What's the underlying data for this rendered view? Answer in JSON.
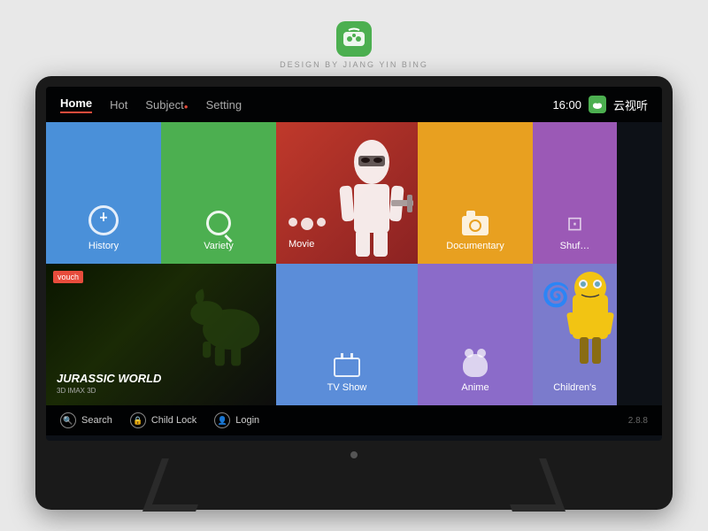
{
  "brand": {
    "tagline": "DESIGN BY JIANG YIN BING"
  },
  "nav": {
    "items": [
      {
        "label": "Home",
        "active": true
      },
      {
        "label": "Hot",
        "active": false
      },
      {
        "label": "Subject",
        "active": false,
        "dot": true
      },
      {
        "label": "Setting",
        "active": false
      }
    ],
    "time": "16:00",
    "service": "云视听"
  },
  "tiles": [
    {
      "id": "history",
      "label": "History",
      "color": "#4a90d9"
    },
    {
      "id": "variety",
      "label": "Variety",
      "color": "#4CAF50"
    },
    {
      "id": "movie",
      "label": "Movie",
      "color": "#e74c3c"
    },
    {
      "id": "documentary",
      "label": "Documentary",
      "color": "#e8a020"
    },
    {
      "id": "shuffle",
      "label": "Shuf…",
      "color": "#9b59b6"
    },
    {
      "id": "jurassic",
      "label": "JURASSIC WORLD",
      "sublabel": "3D IMAX 3D",
      "badge": "vouch"
    },
    {
      "id": "tvshow",
      "label": "TV Show",
      "color": "#5b8dd9"
    },
    {
      "id": "anime",
      "label": "Anime",
      "color": "#8b6bc9"
    },
    {
      "id": "children",
      "label": "Children's",
      "color": "#7b7bcc"
    }
  ],
  "bottom": {
    "actions": [
      {
        "id": "search",
        "label": "Search"
      },
      {
        "id": "childlock",
        "label": "Child Lock"
      },
      {
        "id": "login",
        "label": "Login"
      }
    ],
    "version": "2.8.8"
  }
}
